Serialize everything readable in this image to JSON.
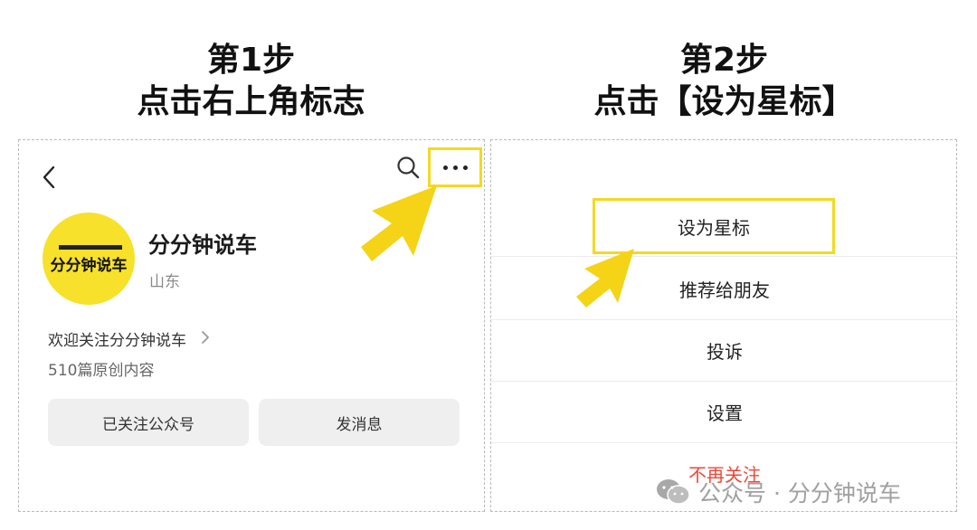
{
  "step1": {
    "title_line1": "第1步",
    "title_line2": "点击右上角标志"
  },
  "step2": {
    "title_line1": "第2步",
    "title_line2": "点击【设为星标】"
  },
  "profile": {
    "avatar_text": "分分钟说车",
    "name": "分分钟说车",
    "region": "山东",
    "welcome": "欢迎关注分分钟说车",
    "article_count": "510篇原创内容",
    "followed_button": "已关注公众号",
    "message_button": "发消息"
  },
  "menu": {
    "items": [
      {
        "label": "设为星标"
      },
      {
        "label": "推荐给朋友"
      },
      {
        "label": "投诉"
      },
      {
        "label": "设置"
      },
      {
        "label": "不再关注"
      }
    ]
  },
  "watermark": {
    "text": "公众号 · 分分钟说车"
  },
  "colors": {
    "highlight": "#f3d924",
    "arrow": "#f5d317",
    "danger": "#e84a3a",
    "avatar_bg": "#f7e12a"
  },
  "icons": [
    "back-icon",
    "search-icon",
    "more-icon",
    "chevron-right-icon",
    "arrow-icon",
    "wechat-icon"
  ]
}
